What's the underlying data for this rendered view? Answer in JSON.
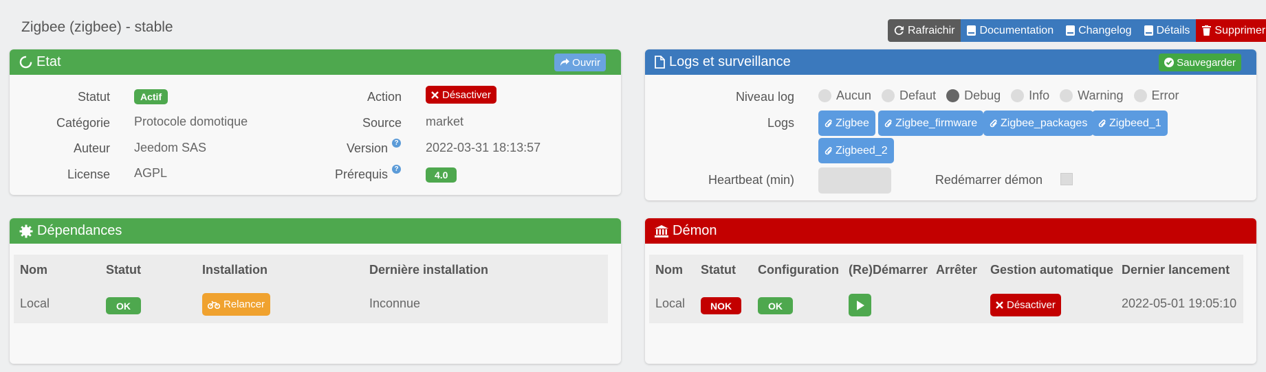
{
  "page": {
    "title": "Zigbee (zigbee) - stable"
  },
  "toolbar": {
    "refresh_label": "Rafraichir",
    "documentation_label": "Documentation",
    "changelog_label": "Changelog",
    "details_label": "Détails",
    "delete_label": "Supprimer"
  },
  "etat": {
    "title": "Etat",
    "open_label": "Ouvrir",
    "labels": {
      "statut": "Statut",
      "categorie": "Catégorie",
      "auteur": "Auteur",
      "license": "License",
      "action": "Action",
      "source": "Source",
      "version": "Version",
      "prerequis": "Prérequis"
    },
    "values": {
      "statut": "Actif",
      "categorie": "Protocole domotique",
      "auteur": "Jeedom SAS",
      "license": "AGPL",
      "action": "Désactiver",
      "source": "market",
      "version": "2022-03-31 18:13:57",
      "prerequis": "4.0"
    },
    "help_mark": "?"
  },
  "logs": {
    "title": "Logs et surveillance",
    "save_label": "Sauvegarder",
    "niveau_label": "Niveau log",
    "levels": [
      "Aucun",
      "Defaut",
      "Debug",
      "Info",
      "Warning",
      "Error"
    ],
    "selected_level": "Debug",
    "logs_label": "Logs",
    "log_files": [
      "Zigbee",
      "Zigbee_firmware",
      "Zigbee_packages",
      "Zigbeed_1",
      "Zigbeed_2"
    ],
    "heartbeat_label": "Heartbeat (min)",
    "heartbeat_value": "",
    "restart_label": "Redémarrer démon"
  },
  "dependances": {
    "title": "Dépendances",
    "headers": [
      "Nom",
      "Statut",
      "Installation",
      "Dernière installation"
    ],
    "row": {
      "nom": "Local",
      "statut": "OK",
      "installation": "Relancer",
      "derniere": "Inconnue"
    }
  },
  "demon": {
    "title": "Démon",
    "headers": [
      "Nom",
      "Statut",
      "Configuration",
      "(Re)Démarrer",
      "Arrêter",
      "Gestion automatique",
      "Dernier lancement"
    ],
    "row": {
      "nom": "Local",
      "statut": "NOK",
      "configuration": "OK",
      "gestion": "Désactiver",
      "dernier": "2022-05-01 19:05:10"
    }
  },
  "colors": {
    "green": "#4ea84e",
    "blue": "#3b79bd",
    "red": "#c30000",
    "orange": "#f0a22f",
    "light_blue": "#5b9be0"
  }
}
